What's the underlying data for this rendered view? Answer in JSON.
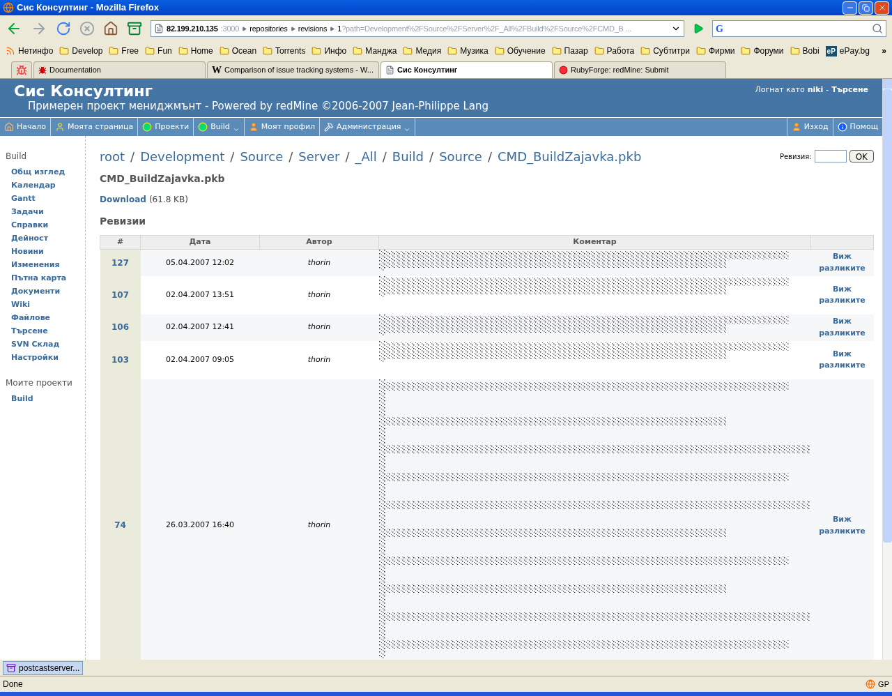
{
  "window": {
    "title": "Сис Консултинг - Mozilla Firefox"
  },
  "address": {
    "host": "82.199.210.135",
    "port": ":3000",
    "parts": [
      "repositories",
      "revisions"
    ],
    "tail_strong": "1",
    "tail": "?path=Development%2FSource%2FServer%2F_All%2FBuild%2FSource%2FCMD_B ..."
  },
  "bookmarks": [
    {
      "label": "Нетинфо",
      "kind": "feed"
    },
    {
      "label": "Develop",
      "kind": "folder"
    },
    {
      "label": "Free",
      "kind": "folder"
    },
    {
      "label": "Fun",
      "kind": "folder"
    },
    {
      "label": "Home",
      "kind": "folder"
    },
    {
      "label": "Ocean",
      "kind": "folder"
    },
    {
      "label": "Torrents",
      "kind": "folder"
    },
    {
      "label": "Инфо",
      "kind": "folder"
    },
    {
      "label": "Манджа",
      "kind": "folder"
    },
    {
      "label": "Медия",
      "kind": "folder"
    },
    {
      "label": "Музика",
      "kind": "folder"
    },
    {
      "label": "Обучение",
      "kind": "folder"
    },
    {
      "label": "Пазар",
      "kind": "folder"
    },
    {
      "label": "Работа",
      "kind": "folder"
    },
    {
      "label": "Субтитри",
      "kind": "folder"
    },
    {
      "label": "Фирми",
      "kind": "folder"
    },
    {
      "label": "Форуми",
      "kind": "folder"
    },
    {
      "label": "Bobi",
      "kind": "folder"
    },
    {
      "label": "ePay.bg",
      "kind": "site",
      "badge": "eP"
    }
  ],
  "bookmarks_more": "»",
  "search_engine": "G",
  "tabs": [
    {
      "kind": "icon",
      "selected": false
    },
    {
      "label": "Documentation",
      "kind": "bug",
      "selected": false
    },
    {
      "label": "Comparison of issue tracking systems - W...",
      "kind": "wiki",
      "badge": "W",
      "selected": false
    },
    {
      "label": "Сис Консултинг",
      "kind": "page",
      "selected": true
    },
    {
      "label": "RubyForge: redMine: Submit",
      "kind": "ruby",
      "selected": false
    }
  ],
  "header": {
    "title": "Сис Консултинг",
    "subtitle": "Примерен проект мениджмънт - Powered by redMine ©2006-2007 Jean-Philippe Lang",
    "logged_as": "Логнат като",
    "user": "niki",
    "separator": "-",
    "search": "Търсене"
  },
  "menu": [
    {
      "label": "Начало",
      "kind": "home",
      "dropdown": false
    },
    {
      "label": "Моята страница",
      "kind": "page",
      "dropdown": false
    },
    {
      "label": "Проекти",
      "kind": "projects",
      "dropdown": false
    },
    {
      "label": "Build",
      "kind": "projects",
      "dropdown": true
    },
    {
      "label": "Моят профил",
      "kind": "user",
      "dropdown": false
    },
    {
      "label": "Администрация",
      "kind": "tools",
      "dropdown": true
    }
  ],
  "menu_right": [
    {
      "label": "Изход",
      "kind": "user"
    },
    {
      "label": "Помощ",
      "kind": "help"
    }
  ],
  "sidebar": {
    "project": "Build",
    "items": [
      "Общ изглед",
      "Календар",
      "Gantt",
      "Задачи",
      "Справки",
      "Дейност",
      "Новини",
      "Изменения",
      "Пътна карта",
      "Документи",
      "Wiki",
      "Файлове",
      "Търсене",
      "SVN Склад",
      "Настройки"
    ],
    "my_projects_title": "Моите проекти",
    "my_projects": [
      "Build"
    ]
  },
  "breadcrumb": [
    "root",
    "Development",
    "Source",
    "Server",
    "_All",
    "Build",
    "Source",
    "CMD_BuildZajavka.pkb"
  ],
  "breadcrumb_separator": "/",
  "revision_form": {
    "label": "Ревизия:",
    "button": "OK"
  },
  "file": {
    "name": "CMD_BuildZajavka.pkb",
    "download": "Download",
    "size": "(61.8 KB)"
  },
  "revisions_title": "Ревизии",
  "table": {
    "columns": [
      "#",
      "Дата",
      "Автор",
      "Коментар"
    ],
    "rows": [
      {
        "rev": "127",
        "date": "05.04.2007 12:02",
        "author": "thorin",
        "action": "Виж разликите"
      },
      {
        "rev": "107",
        "date": "02.04.2007 13:51",
        "author": "thorin",
        "action": "Виж разликите"
      },
      {
        "rev": "106",
        "date": "02.04.2007 12:41",
        "author": "thorin",
        "action": "Виж разликите"
      },
      {
        "rev": "103",
        "date": "02.04.2007 09:05",
        "author": "thorin",
        "action": "Виж разликите"
      },
      {
        "rev": "74",
        "date": "26.03.2007 16:40",
        "author": "thorin",
        "action": "Виж разликите"
      }
    ]
  },
  "downloads": [
    {
      "label": "postcastserver..."
    }
  ],
  "status_bar": {
    "text": "Done",
    "right": "GP"
  }
}
